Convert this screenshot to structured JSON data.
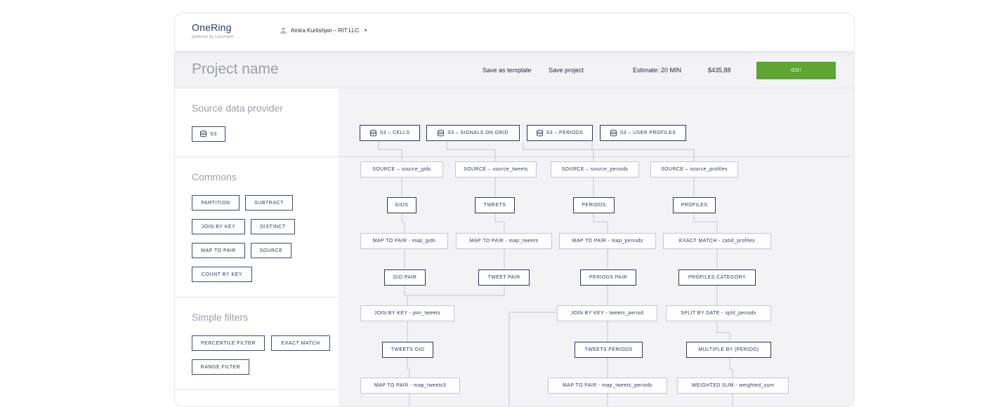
{
  "app": {
    "logo": "OneRing",
    "logo_sub": "powered by Locomizer"
  },
  "user": {
    "name": "Amira Kurtishjan – RIT LLC",
    "menu_caret": "▾"
  },
  "project": {
    "name": "Project name",
    "save_template": "Save as template",
    "save_project": "Save project",
    "estimate": "Estimate: 20 MIN",
    "price": "$435,88",
    "go": "GO!"
  },
  "colors": {
    "accent": "#5da633",
    "node_border": "#2a3566",
    "brand": "#1f3b7a"
  },
  "sidebar": {
    "source": {
      "title": "Source data provider",
      "items": [
        "S3"
      ]
    },
    "commons": {
      "title": "Commons",
      "items": [
        "PARTITION",
        "SUBTRACT",
        "JOIN BY KEY",
        "DISTINCT",
        "MAP TO PAIR",
        "SOURCE",
        "COUNT BY KEY"
      ]
    },
    "filters": {
      "title": "Simple filters",
      "items": [
        "PERCENTILE FILTER",
        "EXACT MATCH",
        "RANGE FILTER"
      ]
    }
  },
  "graph": {
    "sources": [
      "S3 – CELLS",
      "S3 – SIGNALS ON GRID",
      "S3 – PERIODS",
      "S3 – USER PROFILES"
    ],
    "nodes": [
      "SOURCE – source_gids",
      "SOURCE – source_tweets",
      "SOURCE – source_periods",
      "SOURCE – source_profiles",
      "GIDS",
      "TWEETS",
      "PERIODS",
      "PROFILES",
      "MAP TO PAIR - map_gids",
      "MAP TO PAIR - map_tweets",
      "MAP TO PAIR - map_periods",
      "EXACT MATCH - catid_profiles",
      "GID PAIR",
      "TWEET PAIR",
      "PERIODS PAIR",
      "PROFILES CATEGORY",
      "JOIN BY KEY - join_tweets",
      "JOIN BY KEY - tweets_period",
      "SPLIT BY DATE - split_periods",
      "TWEETS GID",
      "TWEETS PERIODS",
      "MULTIPLE BY (PERIOD)",
      "MAP TO PAIR - map_tweets3",
      "MAP TO PAIR - map_tweets_periods",
      "WEIGHTED SUM - weighted_sum"
    ]
  }
}
